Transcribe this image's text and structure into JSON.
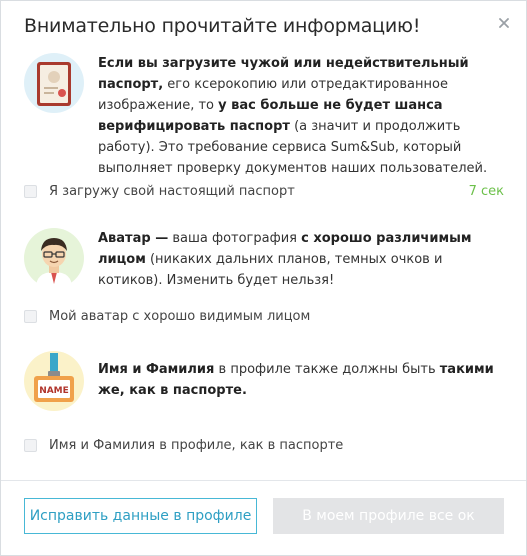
{
  "modal": {
    "title": "Внимательно прочитайте информацию!",
    "close_icon": "close-icon"
  },
  "passport_block": {
    "icon": "passport-document-icon",
    "text_parts": [
      {
        "b": true,
        "t": "Если вы загрузите чужой или недействительный паспорт,"
      },
      {
        "b": false,
        "t": " его ксерокопию или отредактированное изображение, то "
      },
      {
        "b": true,
        "t": "у вас больше не будет шанса верифицировать паспорт"
      },
      {
        "b": false,
        "t": " (а значит и продолжить работу). Это требование сервиса Sum&Sub, который выполняет проверку документов наших пользователей."
      }
    ],
    "checkbox_label": "Я загружу свой настоящий паспорт",
    "timer": "7 сек"
  },
  "avatar_block": {
    "icon": "avatar-person-icon",
    "text_parts": [
      {
        "b": true,
        "t": "Аватар —"
      },
      {
        "b": false,
        "t": " ваша фотография "
      },
      {
        "b": true,
        "t": "с хорошо различимым лицом"
      },
      {
        "b": false,
        "t": " (никаких дальних планов, темных очков и котиков). Изменить будет нельзя!"
      }
    ],
    "checkbox_label": "Мой аватар с хорошо видимым лицом"
  },
  "name_block": {
    "icon": "name-badge-icon",
    "badge_text": "NAME",
    "text_parts": [
      {
        "b": true,
        "t": "Имя и Фамилия"
      },
      {
        "b": false,
        "t": " в профиле также должны быть "
      },
      {
        "b": true,
        "t": "такими же, как в паспорте."
      }
    ],
    "checkbox_label": "Имя и Фамилия в профиле, как в паспорте"
  },
  "footer": {
    "fix_profile_label": "Исправить данные в профиле",
    "profile_ok_label": "В моем профиле все ок"
  },
  "colors": {
    "accent": "#48b8d6",
    "timer": "#6cc04a",
    "disabled_button": "#e3e4e6"
  }
}
